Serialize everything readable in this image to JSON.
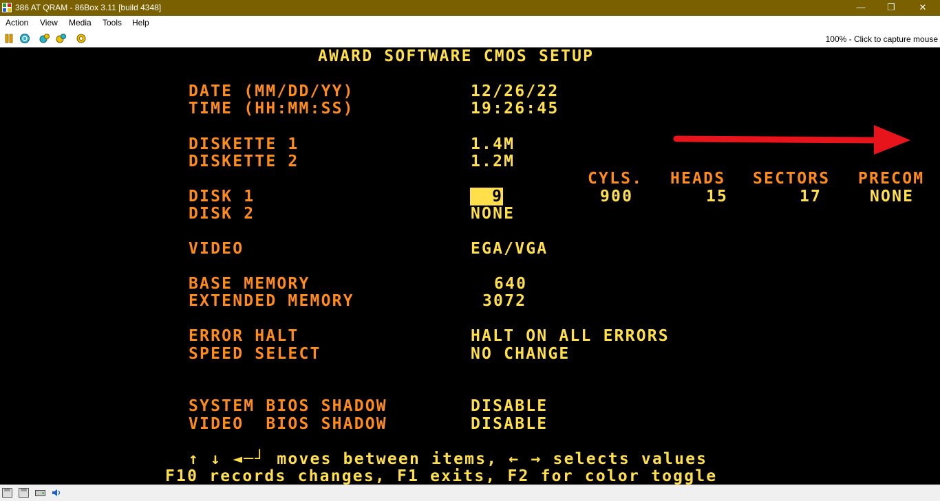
{
  "window": {
    "title": "386 AT QRAM - 86Box 3.11 [build 4348]",
    "minimize_glyph": "—",
    "restore_glyph": "❐",
    "close_glyph": "✕"
  },
  "menu": [
    "Action",
    "View",
    "Media",
    "Tools",
    "Help"
  ],
  "toolbar": {
    "icons": [
      "pause-icon",
      "reset-icon",
      "ctrl-alt-del-icon",
      "ctrl-alt-esc-icon",
      "settings-icon"
    ],
    "status": "100% - Click to capture mouse"
  },
  "bios": {
    "title": "AWARD SOFTWARE CMOS SETUP",
    "date_label": "DATE (MM/DD/YY)",
    "date_value": "12/26/22",
    "time_label": "TIME (HH:MM:SS)",
    "time_value": "19:26:45",
    "diskette1_label": "DISKETTE 1",
    "diskette1_value": "1.4M",
    "diskette2_label": "DISKETTE 2",
    "diskette2_value": "1.2M",
    "disk1_label": "DISK 1",
    "disk1_value": "  9",
    "disk2_label": "DISK 2",
    "disk2_value": "NONE",
    "geometry_headers": [
      "CYLS.",
      "HEADS",
      "SECTORS",
      "PRECOM"
    ],
    "geometry_values": [
      "900",
      "15",
      "17",
      "NONE"
    ],
    "video_label": "VIDEO",
    "video_value": "EGA/VGA",
    "base_mem_label": "BASE MEMORY",
    "base_mem_value": "640",
    "ext_mem_label": "EXTENDED MEMORY",
    "ext_mem_value": "3072",
    "error_halt_label": "ERROR HALT",
    "error_halt_value": "HALT ON ALL ERRORS",
    "speed_label": "SPEED SELECT",
    "speed_value": "NO CHANGE",
    "sys_shadow_label": "SYSTEM BIOS SHADOW",
    "sys_shadow_value": "DISABLE",
    "vid_shadow_label": "VIDEO  BIOS SHADOW",
    "vid_shadow_value": "DISABLE",
    "help_line1": "↑ ↓ ◄─┘ moves between items, ← → selects values",
    "help_line2": "F10 records changes, F1 exits, F2 for color toggle"
  },
  "annotation_color": "#e8141c",
  "statusbar_icons": [
    "floppy-1-icon",
    "floppy-2-icon",
    "hard-disk-icon",
    "sound-icon"
  ]
}
